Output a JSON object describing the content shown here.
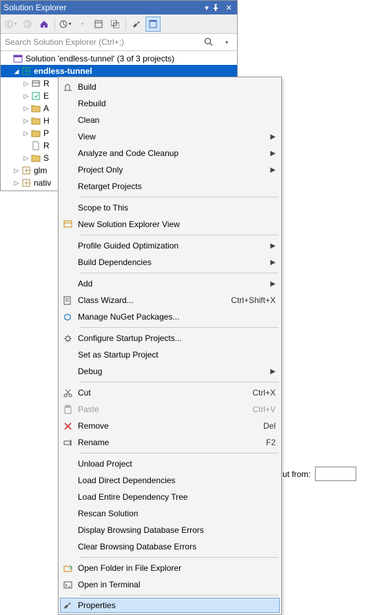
{
  "panel": {
    "title": "Solution Explorer",
    "search_placeholder": "Search Solution Explorer (Ctrl+;)",
    "solution_text": "Solution 'endless-tunnel' (3 of 3 projects)"
  },
  "header_icons": {
    "dropdown": "▾",
    "pin": "📌",
    "close": "✕"
  },
  "tree": [
    {
      "label": "endless-tunnel",
      "bold": true,
      "selected": true,
      "exp": "open",
      "indent": 1
    },
    {
      "label": "R",
      "exp": "closed",
      "indent": 2,
      "icon": "ref"
    },
    {
      "label": "E",
      "exp": "closed",
      "indent": 2,
      "icon": "ext"
    },
    {
      "label": "A",
      "exp": "closed",
      "indent": 2,
      "icon": "folder"
    },
    {
      "label": "H",
      "exp": "closed",
      "indent": 2,
      "icon": "folder"
    },
    {
      "label": "P",
      "exp": "closed",
      "indent": 2,
      "icon": "folder"
    },
    {
      "label": "R",
      "exp": "",
      "indent": 2,
      "icon": "file"
    },
    {
      "label": "S",
      "exp": "closed",
      "indent": 2,
      "icon": "folder"
    },
    {
      "label": "glm",
      "exp": "closed",
      "indent": 1,
      "icon": "proj"
    },
    {
      "label": "nativ",
      "exp": "closed",
      "indent": 1,
      "icon": "proj"
    }
  ],
  "menu": [
    {
      "type": "item",
      "label": "Build",
      "icon": "build"
    },
    {
      "type": "item",
      "label": "Rebuild"
    },
    {
      "type": "item",
      "label": "Clean"
    },
    {
      "type": "item",
      "label": "View",
      "submenu": true
    },
    {
      "type": "item",
      "label": "Analyze and Code Cleanup",
      "submenu": true
    },
    {
      "type": "item",
      "label": "Project Only",
      "submenu": true
    },
    {
      "type": "item",
      "label": "Retarget Projects"
    },
    {
      "type": "sep"
    },
    {
      "type": "item",
      "label": "Scope to This"
    },
    {
      "type": "item",
      "label": "New Solution Explorer View",
      "icon": "newview"
    },
    {
      "type": "sep"
    },
    {
      "type": "item",
      "label": "Profile Guided Optimization",
      "submenu": true
    },
    {
      "type": "item",
      "label": "Build Dependencies",
      "submenu": true
    },
    {
      "type": "sep"
    },
    {
      "type": "item",
      "label": "Add",
      "submenu": true
    },
    {
      "type": "item",
      "label": "Class Wizard...",
      "icon": "wizard",
      "shortcut": "Ctrl+Shift+X"
    },
    {
      "type": "item",
      "label": "Manage NuGet Packages...",
      "icon": "nuget"
    },
    {
      "type": "sep"
    },
    {
      "type": "item",
      "label": "Configure Startup Projects...",
      "icon": "gear"
    },
    {
      "type": "item",
      "label": "Set as Startup Project"
    },
    {
      "type": "item",
      "label": "Debug",
      "submenu": true
    },
    {
      "type": "sep"
    },
    {
      "type": "item",
      "label": "Cut",
      "icon": "cut",
      "shortcut": "Ctrl+X"
    },
    {
      "type": "item",
      "label": "Paste",
      "icon": "paste",
      "shortcut": "Ctrl+V",
      "disabled": true
    },
    {
      "type": "item",
      "label": "Remove",
      "icon": "remove",
      "shortcut": "Del"
    },
    {
      "type": "item",
      "label": "Rename",
      "icon": "rename",
      "shortcut": "F2"
    },
    {
      "type": "sep"
    },
    {
      "type": "item",
      "label": "Unload Project"
    },
    {
      "type": "item",
      "label": "Load Direct Dependencies"
    },
    {
      "type": "item",
      "label": "Load Entire Dependency Tree"
    },
    {
      "type": "item",
      "label": "Rescan Solution"
    },
    {
      "type": "item",
      "label": "Display Browsing Database Errors"
    },
    {
      "type": "item",
      "label": "Clear Browsing Database Errors"
    },
    {
      "type": "sep"
    },
    {
      "type": "item",
      "label": "Open Folder in File Explorer",
      "icon": "folder"
    },
    {
      "type": "item",
      "label": "Open in Terminal",
      "icon": "terminal"
    },
    {
      "type": "sep"
    },
    {
      "type": "item",
      "label": "Properties",
      "icon": "wrench",
      "selected": true
    }
  ],
  "bottom": {
    "label": "ut from:"
  }
}
